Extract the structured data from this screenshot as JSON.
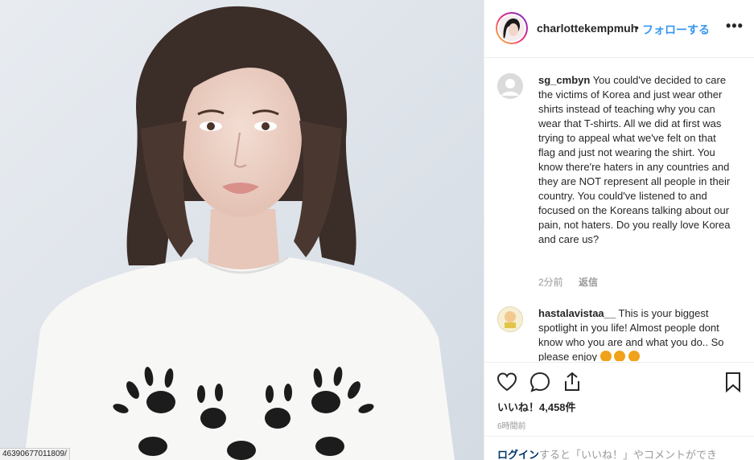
{
  "photo": {
    "url_fragment": "46390677011809/"
  },
  "post": {
    "username": "charlottekempmuh",
    "dot": "•",
    "follow_label": "フォローする",
    "more_label": "•••"
  },
  "comments": [
    {
      "username": "sg_cmbyn",
      "text": "You could've decided to care the victims of Korea and just wear other shirts instead of teaching why you can wear that T-shirts. All we did at first was trying to appeal what we've felt on that flag and just not wearing the shirt. You know there're haters in any countries and they are NOT represent all people in their country. You could've listened to and focused on the Koreans talking about our pain, not haters. Do you really love Korea and care us?",
      "time": "2分前",
      "reply": "返信"
    },
    {
      "username": "hastalavistaa__",
      "text": "This is your biggest spotlight in you life! Almost people dont know who you are and what you do.. So please enjoy"
    }
  ],
  "likes": "いいね！4,458件",
  "timestamp": "6時間前",
  "login_prompt": {
    "link": "ログイン",
    "text": "すると「いいね！」やコメントができ"
  },
  "icons": [
    "heart-icon",
    "comment-icon",
    "share-icon",
    "bookmark-icon"
  ],
  "colors": {
    "link_blue": "#3897f0",
    "text": "#262626",
    "muted": "#999999"
  }
}
